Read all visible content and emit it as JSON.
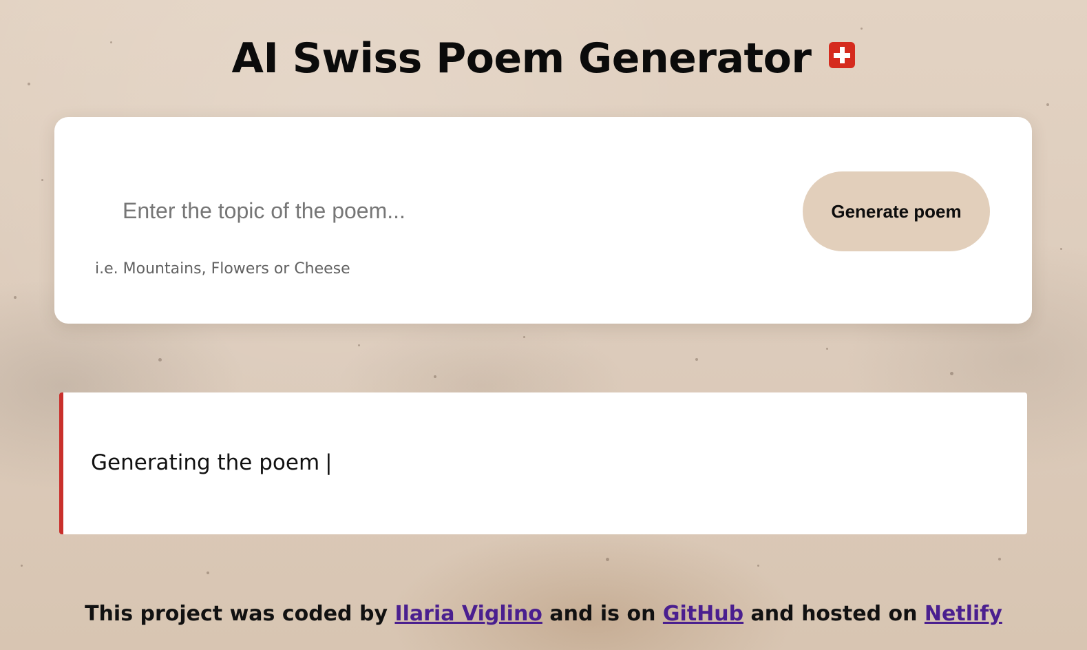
{
  "header": {
    "title": "AI Swiss Poem Generator",
    "flag_icon": "swiss-flag-icon"
  },
  "form": {
    "input_placeholder": "Enter the topic of the poem...",
    "hint": "i.e. Mountains, Flowers or Cheese",
    "button_label": "Generate poem"
  },
  "poem": {
    "status_text": "Generating the poem",
    "cursor": "|",
    "accent_color": "#c9302c"
  },
  "footer": {
    "text_1": "This project was coded by",
    "author_link": "Ilaria Viglino",
    "text_2": "and is on",
    "github_link": "GitHub",
    "text_3": "and hosted on",
    "netlify_link": "Netlify"
  },
  "colors": {
    "background": "#e0cfbf",
    "button_bg": "#e2cfbb",
    "link": "#4a1f8f"
  }
}
